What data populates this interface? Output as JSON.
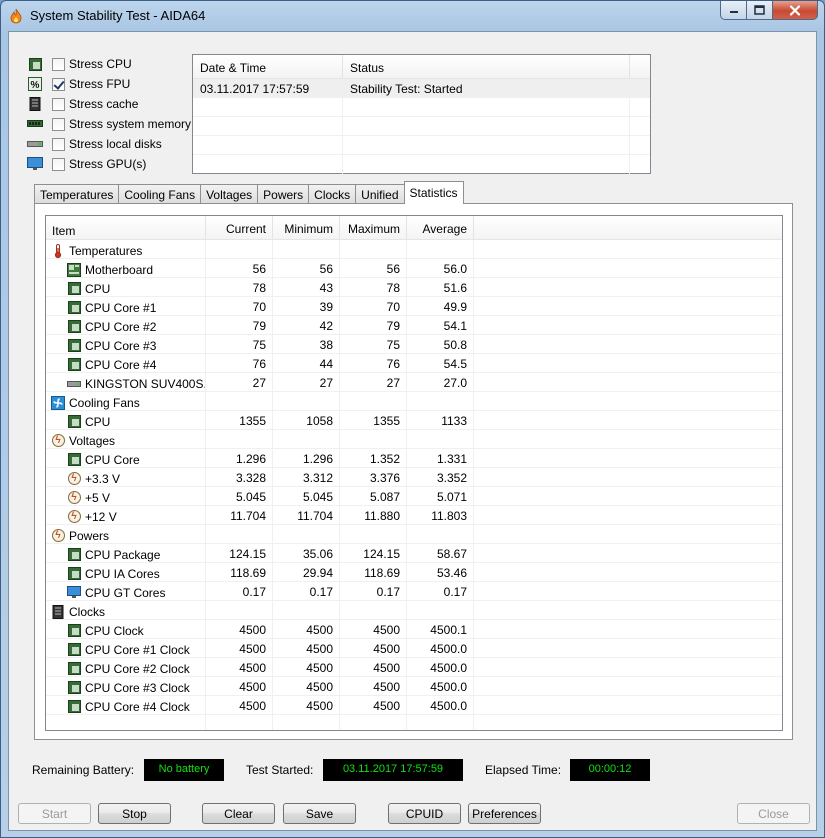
{
  "window": {
    "title": "System Stability Test - AIDA64"
  },
  "stress": [
    {
      "label": "Stress CPU",
      "checked": false,
      "icon": "cpu-chip-icon"
    },
    {
      "label": "Stress FPU",
      "checked": true,
      "icon": "fpu-percent-icon"
    },
    {
      "label": "Stress cache",
      "checked": false,
      "icon": "cache-chip-icon"
    },
    {
      "label": "Stress system memory",
      "checked": false,
      "icon": "memory-module-icon"
    },
    {
      "label": "Stress local disks",
      "checked": false,
      "icon": "disk-drive-icon"
    },
    {
      "label": "Stress GPU(s)",
      "checked": false,
      "icon": "monitor-icon"
    }
  ],
  "log": {
    "headers": [
      "Date & Time",
      "Status"
    ],
    "rows": [
      {
        "datetime": "03.11.2017 17:57:59",
        "status": "Stability Test: Started"
      }
    ]
  },
  "tabs": [
    "Temperatures",
    "Cooling Fans",
    "Voltages",
    "Powers",
    "Clocks",
    "Unified",
    "Statistics"
  ],
  "active_tab": "Statistics",
  "stats": {
    "headers": [
      "Item",
      "Current",
      "Minimum",
      "Maximum",
      "Average"
    ],
    "rows": [
      {
        "type": "group",
        "name": "Temperatures",
        "icon": "thermometer-icon"
      },
      {
        "type": "item",
        "name": "Motherboard",
        "icon": "motherboard-icon",
        "cur": "56",
        "min": "56",
        "max": "56",
        "avg": "56.0"
      },
      {
        "type": "item",
        "name": "CPU",
        "icon": "chip-icon",
        "cur": "78",
        "min": "43",
        "max": "78",
        "avg": "51.6"
      },
      {
        "type": "item",
        "name": "CPU Core #1",
        "icon": "chip-icon",
        "cur": "70",
        "min": "39",
        "max": "70",
        "avg": "49.9"
      },
      {
        "type": "item",
        "name": "CPU Core #2",
        "icon": "chip-icon",
        "cur": "79",
        "min": "42",
        "max": "79",
        "avg": "54.1"
      },
      {
        "type": "item",
        "name": "CPU Core #3",
        "icon": "chip-icon",
        "cur": "75",
        "min": "38",
        "max": "75",
        "avg": "50.8"
      },
      {
        "type": "item",
        "name": "CPU Core #4",
        "icon": "chip-icon",
        "cur": "76",
        "min": "44",
        "max": "76",
        "avg": "54.5"
      },
      {
        "type": "item",
        "name": "KINGSTON SUV400S...",
        "icon": "disk-icon",
        "cur": "27",
        "min": "27",
        "max": "27",
        "avg": "27.0"
      },
      {
        "type": "group",
        "name": "Cooling Fans",
        "icon": "fan-icon"
      },
      {
        "type": "item",
        "name": "CPU",
        "icon": "chip-icon",
        "cur": "1355",
        "min": "1058",
        "max": "1355",
        "avg": "1133"
      },
      {
        "type": "group",
        "name": "Voltages",
        "icon": "bolt-icon"
      },
      {
        "type": "item",
        "name": "CPU Core",
        "icon": "chip-icon",
        "cur": "1.296",
        "min": "1.296",
        "max": "1.352",
        "avg": "1.331"
      },
      {
        "type": "item",
        "name": "+3.3 V",
        "icon": "bolt-icon",
        "cur": "3.328",
        "min": "3.312",
        "max": "3.376",
        "avg": "3.352"
      },
      {
        "type": "item",
        "name": "+5 V",
        "icon": "bolt-icon",
        "cur": "5.045",
        "min": "5.045",
        "max": "5.087",
        "avg": "5.071"
      },
      {
        "type": "item",
        "name": "+12 V",
        "icon": "bolt-icon",
        "cur": "11.704",
        "min": "11.704",
        "max": "11.880",
        "avg": "11.803"
      },
      {
        "type": "group",
        "name": "Powers",
        "icon": "bolt-icon"
      },
      {
        "type": "item",
        "name": "CPU Package",
        "icon": "chip-icon",
        "cur": "124.15",
        "min": "35.06",
        "max": "124.15",
        "avg": "58.67"
      },
      {
        "type": "item",
        "name": "CPU IA Cores",
        "icon": "chip-icon",
        "cur": "118.69",
        "min": "29.94",
        "max": "118.69",
        "avg": "53.46"
      },
      {
        "type": "item",
        "name": "CPU GT Cores",
        "icon": "monitor-icon",
        "cur": "0.17",
        "min": "0.17",
        "max": "0.17",
        "avg": "0.17"
      },
      {
        "type": "group",
        "name": "Clocks",
        "icon": "clock-chip-icon"
      },
      {
        "type": "item",
        "name": "CPU Clock",
        "icon": "chip-icon",
        "cur": "4500",
        "min": "4500",
        "max": "4500",
        "avg": "4500.1"
      },
      {
        "type": "item",
        "name": "CPU Core #1 Clock",
        "icon": "chip-icon",
        "cur": "4500",
        "min": "4500",
        "max": "4500",
        "avg": "4500.0"
      },
      {
        "type": "item",
        "name": "CPU Core #2 Clock",
        "icon": "chip-icon",
        "cur": "4500",
        "min": "4500",
        "max": "4500",
        "avg": "4500.0"
      },
      {
        "type": "item",
        "name": "CPU Core #3 Clock",
        "icon": "chip-icon",
        "cur": "4500",
        "min": "4500",
        "max": "4500",
        "avg": "4500.0"
      },
      {
        "type": "item",
        "name": "CPU Core #4 Clock",
        "icon": "chip-icon",
        "cur": "4500",
        "min": "4500",
        "max": "4500",
        "avg": "4500.0"
      }
    ]
  },
  "status": {
    "battery_label": "Remaining Battery:",
    "battery_value": "No battery",
    "started_label": "Test Started:",
    "started_value": "03.11.2017 17:57:59",
    "elapsed_label": "Elapsed Time:",
    "elapsed_value": "00:00:12"
  },
  "buttons": {
    "start": "Start",
    "stop": "Stop",
    "clear": "Clear",
    "save": "Save",
    "cpuid": "CPUID",
    "preferences": "Preferences",
    "close": "Close"
  },
  "colors": {
    "lcd_bg": "#000000",
    "lcd_text": "#11e011"
  }
}
